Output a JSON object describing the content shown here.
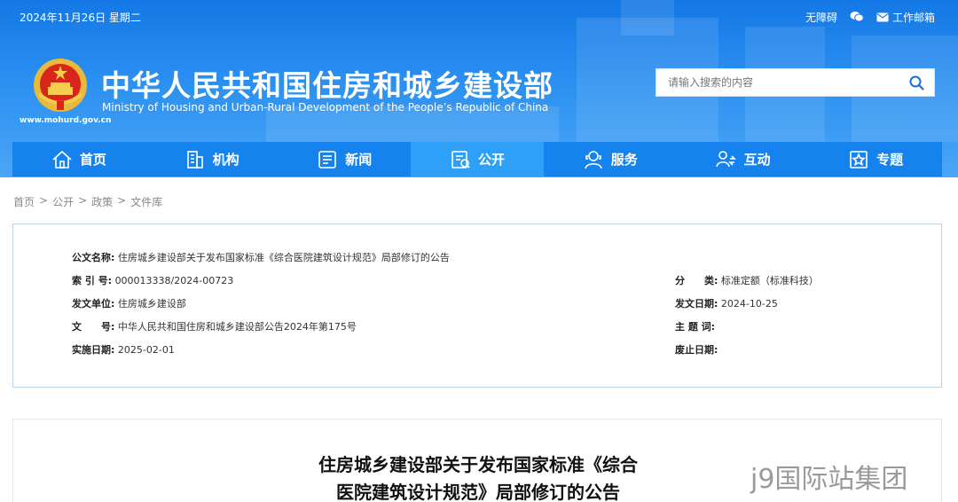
{
  "header": {
    "date": "2024年11月26日 星期二",
    "links": {
      "accessibility": "无障碍",
      "mail": "工作邮箱"
    },
    "domain": "www.mohurd.gov.cn",
    "title": "中华人民共和国住房和城乡建设部",
    "subtitle": "Ministry of Housing and Urban-Rural Development of the People’s Republic of China",
    "search_placeholder": "请输入搜索的内容"
  },
  "nav": [
    {
      "label": "首页",
      "icon": "home-icon"
    },
    {
      "label": "机构",
      "icon": "building-icon"
    },
    {
      "label": "新闻",
      "icon": "news-icon"
    },
    {
      "label": "公开",
      "icon": "public-icon",
      "active": true
    },
    {
      "label": "服务",
      "icon": "service-icon"
    },
    {
      "label": "互动",
      "icon": "interact-icon"
    },
    {
      "label": "专题",
      "icon": "topic-icon"
    }
  ],
  "breadcrumb": [
    "首页",
    "公开",
    "政策",
    "文件库"
  ],
  "info": {
    "name_label": "公文名称:",
    "name_value": "住房城乡建设部关于发布国家标准《综合医院建筑设计规范》局部修订的公告",
    "index_label": "索 引 号:",
    "index_value": "000013338/2024-00723",
    "category_label": "分　　类:",
    "category_value": "标准定额（标准科技）",
    "issuer_label": "发文单位:",
    "issuer_value": "住房城乡建设部",
    "issue_date_label": "发文日期:",
    "issue_date_value": "2024-10-25",
    "docno_label": "文　　号:",
    "docno_value": "中华人民共和国住房和城乡建设部公告2024年第175号",
    "subject_label": "主 题 词:",
    "subject_value": "",
    "effective_label": "实施日期:",
    "effective_value": "2025-02-01",
    "expiry_label": "废止日期:",
    "expiry_value": ""
  },
  "article": {
    "title_line1": "住房城乡建设部关于发布国家标准《综合",
    "title_line2": "医院建筑设计规范》局部修订的公告"
  },
  "watermark": "j9国际站集团",
  "colors": {
    "header": "#1582ee",
    "nav_active": "#2fa0f8",
    "border": "#b9d3ea"
  }
}
